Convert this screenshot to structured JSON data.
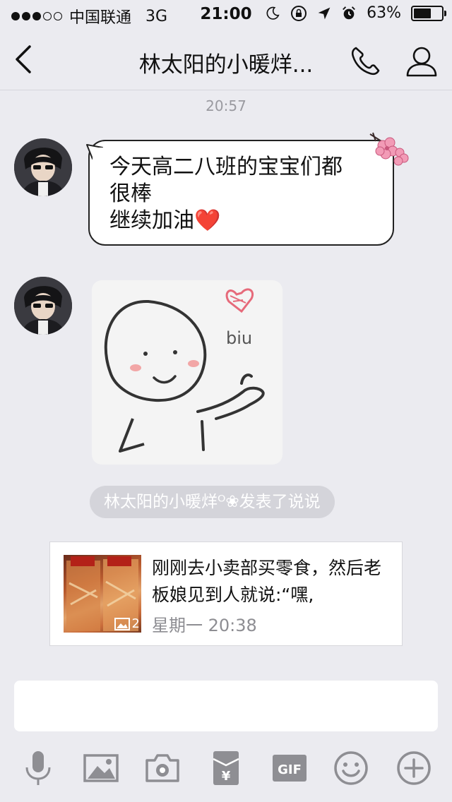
{
  "status_bar": {
    "carrier": "中国联通",
    "network": "3G",
    "time": "21:00",
    "battery_text": "63%",
    "battery_level": 0.63,
    "signal_bars": 3,
    "icons": [
      "moon-icon",
      "orientation-lock-icon",
      "location-icon",
      "alarm-icon"
    ]
  },
  "nav": {
    "title": "林太阳的小暖烊...",
    "back_icon": "chevron-left-icon",
    "call_icon": "phone-icon",
    "profile_icon": "profile-icon"
  },
  "chat": {
    "timestamp": "20:57",
    "message_lines": [
      "今天高二八班的宝宝们都",
      "很棒",
      "继续加油"
    ],
    "message_emoji": "❤️",
    "sticker_caption": "biu",
    "system_notice": "林太阳的小暖烊ᴼ❀发表了说说",
    "post": {
      "text": "刚刚去小卖部买零食，然后老板娘见到人就说:“嘿,",
      "date": "星期一 20:38",
      "image_count": "2"
    }
  },
  "toolbar": {
    "items": [
      "mic-icon",
      "image-icon",
      "camera-icon",
      "red-envelope-icon",
      "gif-icon",
      "emoji-icon",
      "plus-icon"
    ],
    "gif_label": "GIF",
    "red_envelope_label": "¥"
  },
  "colors": {
    "background": "#ebebf0",
    "heart": "#e8232f",
    "toolbar_icon": "#8e8e93",
    "system_pill": "#d4d4da"
  }
}
